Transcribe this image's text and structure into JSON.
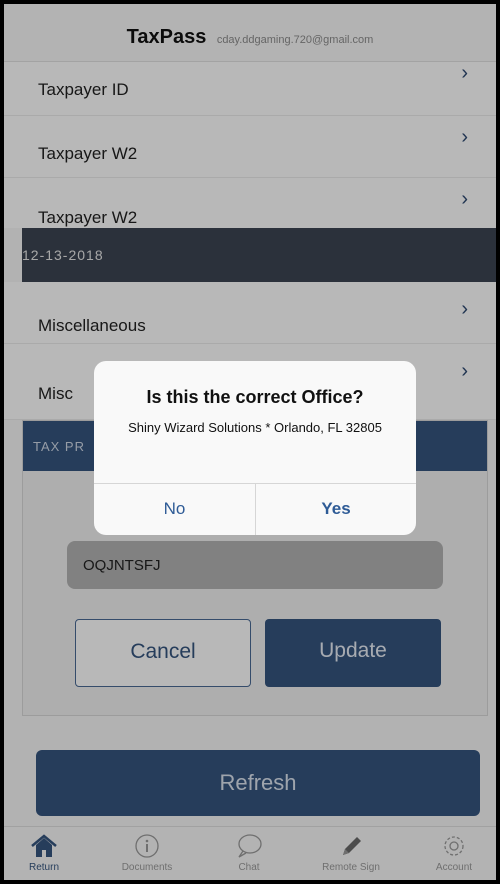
{
  "header": {
    "title": "TaxPass",
    "email": "cday.ddgaming.720@gmail.com"
  },
  "documents": [
    {
      "label": "Taxpayer ID"
    },
    {
      "label": "Taxpayer W2"
    },
    {
      "label": "Taxpayer W2"
    },
    {
      "label": "Miscellaneous"
    },
    {
      "label": "Misc"
    }
  ],
  "date_group": "12-13-2018",
  "panel": {
    "heading": "TAX PR",
    "code_value": "OQJNTSFJ",
    "cancel_label": "Cancel",
    "update_label": "Update"
  },
  "refresh_label": "Refresh",
  "dialog": {
    "title": "Is this the correct Office?",
    "message": "Shiny Wizard Solutions * Orlando, FL 32805",
    "no_label": "No",
    "yes_label": "Yes"
  },
  "tabs": [
    {
      "label": "Return",
      "icon": "home-icon",
      "active": true
    },
    {
      "label": "Documents",
      "icon": "info-icon",
      "active": false
    },
    {
      "label": "Chat",
      "icon": "chat-icon",
      "active": false
    },
    {
      "label": "Remote Sign",
      "icon": "pencil-icon",
      "active": false
    },
    {
      "label": "Account",
      "icon": "gear-icon",
      "active": false
    }
  ],
  "colors": {
    "accent": "#35557f",
    "date_bar": "#3c4452",
    "dialog_button": "#2e5b96"
  }
}
